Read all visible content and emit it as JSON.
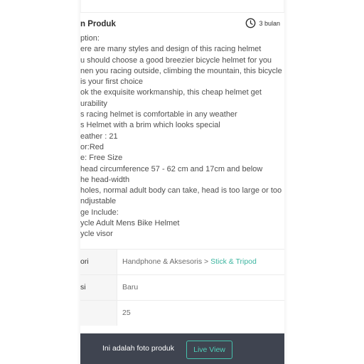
{
  "header": {
    "title": "n Produk",
    "time": "3 bulan",
    "time_icon": "clock-icon"
  },
  "description": {
    "lines": [
      "ption:",
      "ere are many styles and design of this racing helmet",
      "u should choose a good breezier bicycle helmet for you",
      "nen you racing outside, climbing the mountain, this bicycle",
      " is your first choice",
      "ok the exquisite workmanship, this cheap helmet get",
      "urability",
      "s racing helmet is comfortable in any weather",
      "s Helmet with a brim which looks special",
      "eather : 21",
      "or:Red",
      "e: Free Size",
      " head circumference 57 - 62 cm and 17cm and below",
      "he head-width",
      "holes, normal adult body can take, head is too large or too",
      "ndjustable",
      "ge Include:",
      "ycle Adult Mens Bike Helmet",
      "ycle visor"
    ]
  },
  "info_table": {
    "category": {
      "label": "ori",
      "path": "Handphone & Aksesoris",
      "separator": ">",
      "link": "Stick & Tripod"
    },
    "condition": {
      "label": "si",
      "value": "Baru"
    },
    "weight": {
      "label": "",
      "value": "25"
    }
  },
  "bottom_bar": {
    "text": "Ini adalah foto produk",
    "button": "Live View"
  },
  "colors": {
    "accent": "#3db5a0",
    "bar_background": "#3f4450"
  }
}
